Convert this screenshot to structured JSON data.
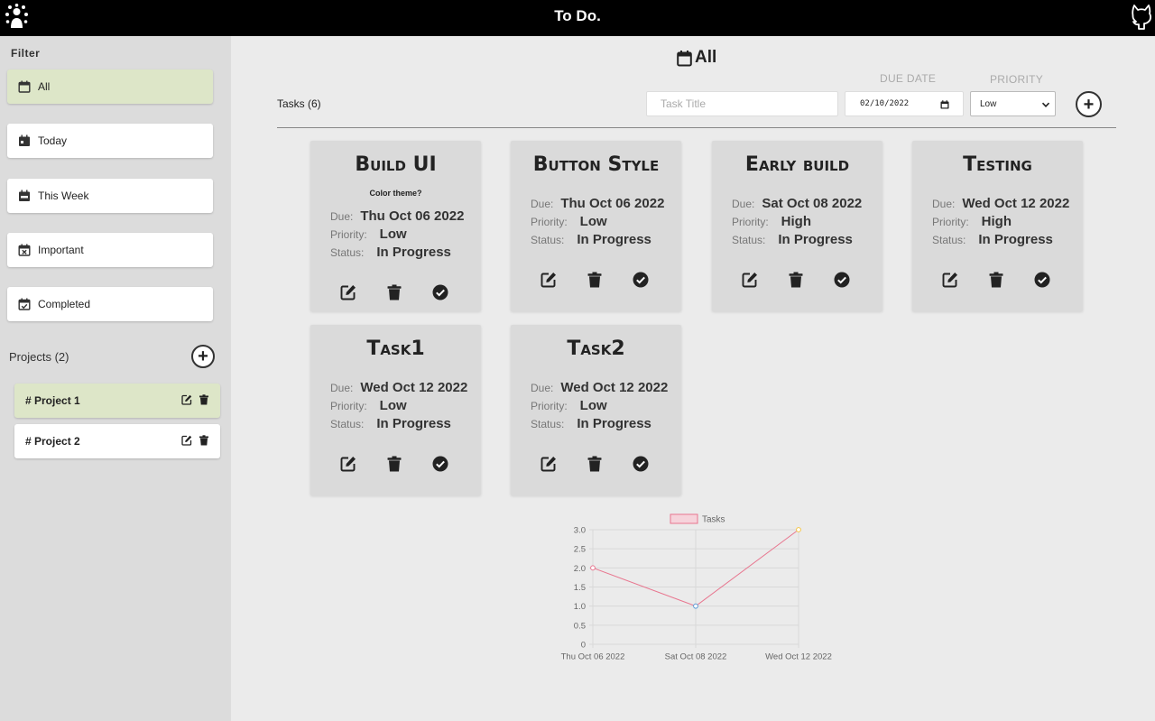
{
  "header": {
    "title": "To Do."
  },
  "sidebar": {
    "filter_heading": "Filter",
    "filters": [
      {
        "label": "All",
        "icon": "calendar-icon",
        "active": true
      },
      {
        "label": "Today",
        "icon": "calendar-day-icon",
        "active": false
      },
      {
        "label": "This Week",
        "icon": "calendar-week-icon",
        "active": false
      },
      {
        "label": "Important",
        "icon": "calendar-x-icon",
        "active": false
      },
      {
        "label": "Completed",
        "icon": "calendar-check-icon",
        "active": false
      }
    ],
    "projects_heading": "Projects (2)",
    "projects": [
      {
        "label": "# Project 1",
        "active": true
      },
      {
        "label": "# Project 2",
        "active": false
      }
    ]
  },
  "main": {
    "title": "All",
    "tasks_count": "Tasks (6)",
    "form": {
      "title_placeholder": "Task Title",
      "due_label": "DUE DATE",
      "due_value": "02/10/2022",
      "priority_label": "PRIORITY",
      "priority_value": "Low"
    },
    "labels": {
      "due": "Due:",
      "priority": "Priority:",
      "status": "Status:"
    },
    "tasks": [
      {
        "title": "Build UI",
        "description": "Color theme?",
        "due": "Thu Oct 06 2022",
        "priority": "Low",
        "status": "In Progress"
      },
      {
        "title": "Button Style",
        "description": "",
        "due": "Thu Oct 06 2022",
        "priority": "Low",
        "status": "In Progress"
      },
      {
        "title": "Early build",
        "description": "",
        "due": "Sat Oct 08 2022",
        "priority": "High",
        "status": "In Progress"
      },
      {
        "title": "Testing",
        "description": "",
        "due": "Wed Oct 12 2022",
        "priority": "High",
        "status": "In Progress"
      },
      {
        "title": "Task1",
        "description": "",
        "due": "Wed Oct 12 2022",
        "priority": "Low",
        "status": "In Progress"
      },
      {
        "title": "Task2",
        "description": "",
        "due": "Wed Oct 12 2022",
        "priority": "Low",
        "status": "In Progress"
      }
    ]
  },
  "colors": {
    "header_bg": "#000000",
    "active_item": "#dde6c8",
    "card_bg": "#dadada",
    "line": "#e8768f"
  },
  "chart_data": {
    "type": "line",
    "categories": [
      "Thu Oct 06 2022",
      "Sat Oct 08 2022",
      "Wed Oct 12 2022"
    ],
    "series": [
      {
        "name": "Tasks",
        "values": [
          2,
          1,
          3
        ]
      }
    ],
    "point_colors": [
      "#e8768f",
      "#5b9bd5",
      "#f5c542"
    ],
    "ylim": [
      0,
      3
    ],
    "yticks": [
      "0",
      "0.5",
      "1.0",
      "1.5",
      "2.0",
      "2.5",
      "3.0"
    ],
    "legend": "top",
    "grid": true
  }
}
